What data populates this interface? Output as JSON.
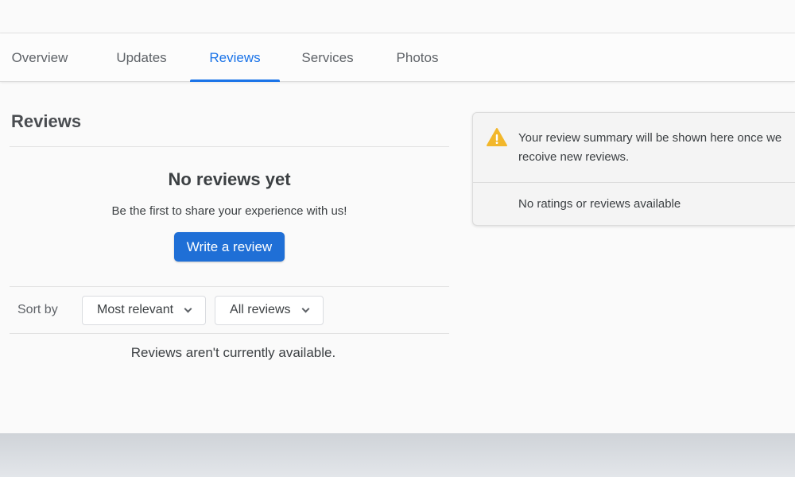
{
  "tabs": [
    {
      "label": "Overview"
    },
    {
      "label": "Updates"
    },
    {
      "label": "Reviews",
      "active": true
    },
    {
      "label": "Services"
    },
    {
      "label": "Photos"
    }
  ],
  "reviews": {
    "title": "Reviews",
    "empty_heading": "No reviews yet",
    "empty_subtext": "Be the first to share your experience with us!",
    "write_button": "Write a review",
    "sort_label": "Sort by",
    "sort_value": "Most relevant",
    "filter_value": "All reviews",
    "unavailable_text": "Reviews aren't currently available."
  },
  "summary": {
    "icon": "warning-icon",
    "message": "Your review summary will be shown here once we recoive new reviews.",
    "no_ratings": "No ratings or reviews available"
  },
  "colors": {
    "accent": "#1a73e8",
    "button": "#1f6fd6",
    "warning": "#f2b72b"
  }
}
